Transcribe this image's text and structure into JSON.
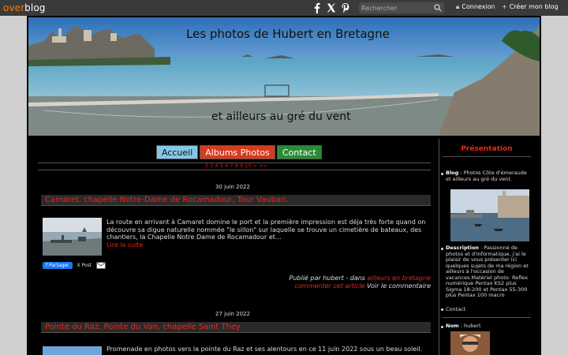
{
  "topbar": {
    "logo_over": "over",
    "logo_blog": "blog",
    "social_icons": [
      "facebook-icon",
      "x-icon",
      "pinterest-icon"
    ],
    "search_placeholder": "Rechercher",
    "login_label": "Connexion",
    "create_label": "Créer mon blog"
  },
  "banner": {
    "title": "Les photos de Hubert en Bretagne",
    "subtitle": "et ailleurs au gré du vent"
  },
  "nav": {
    "home": "Accueil",
    "albums": "Albums Photos",
    "contact": "Contact",
    "pager": "2 3 4 5 6 7 8 9 10 > >>"
  },
  "posts": [
    {
      "date": "30 juin 2022",
      "title": "Camaret, chapelle Notre-Dame de Rocamadour, Tour Vauban.",
      "excerpt": "La route en arrivant à Camaret domine le port et la première impression est déja très forte quand on découvre sa digue naturelle nommée \"le sillon\" sur laquelle se trouve un cimetière de bateaux, des chantiers, la Chapelle Notre Dame de Rocamadour et...",
      "read_more": "Lire la suite",
      "share_fb": "Partager",
      "share_x": "X Post",
      "published_by": "Publié par hubert - dans",
      "category": "ailleurs en bretagne",
      "comment_link": "commenter cet article",
      "view_comment": "Voir le commentaire"
    },
    {
      "date": "27 juin 2022",
      "title": "Pointe du Raz, Pointe du Van, chapelle Saint They",
      "excerpt": "Promenade en photos vers la pointe du Raz et ses alentours en ce 11 juin 2022 sous un beau soleil."
    }
  ],
  "sidebar": {
    "title": "Présentation",
    "blog_label": "Blog",
    "blog_text": " : Photos Côte d'émeraude et ailleurs au gré du vent.",
    "description_label": "Description",
    "description_text": " : Passionné de photos et d'informatique, j'ai le plaisir de vous présenter ici quelques sujets de ma région et ailleurs à l'occasion de vacances.Matériel photo: Reflex numérique Pentax KS2 plus Sigma 18-200 et Pentax 55-300 plus Pentax 100 macro",
    "contact": "Contact",
    "name_label": "Nom",
    "name_value": " : hubert"
  }
}
